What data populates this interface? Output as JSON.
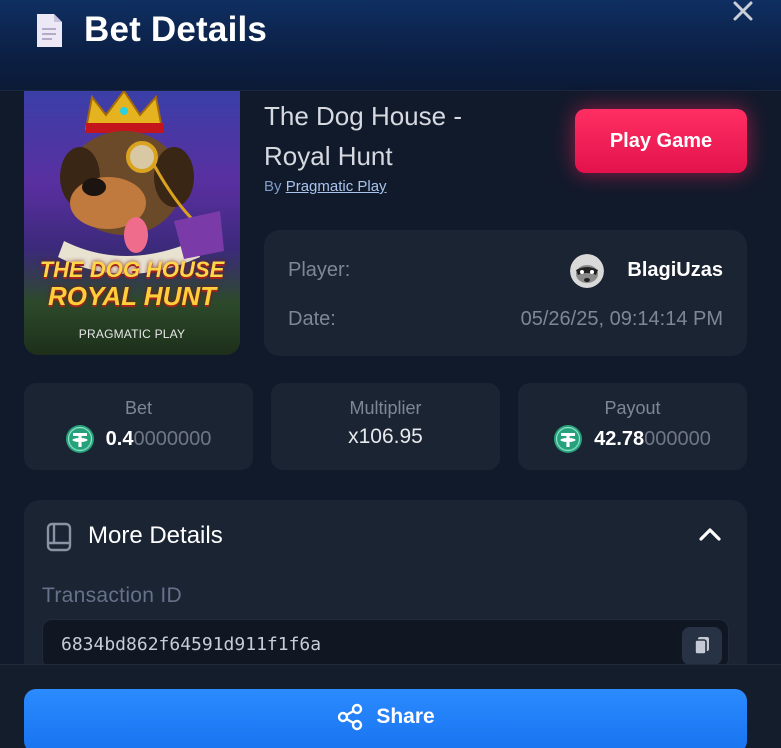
{
  "header": {
    "title": "Bet Details",
    "doc_icon": "document-icon",
    "close_icon": "close-icon"
  },
  "game": {
    "name_line1": "The Dog House -",
    "name_line2": "Royal Hunt",
    "by_label": "By",
    "provider": "Pragmatic Play",
    "thumbnail": {
      "title1": "THE DOG HOUSE",
      "title2": "ROYAL HUNT",
      "provider": "PRAGMATIC PLAY"
    },
    "play_label": "Play Game"
  },
  "info": {
    "player_label": "Player:",
    "player_name": "BlagiUzas",
    "date_label": "Date:",
    "date_value": "05/26/25, 09:14:14 PM"
  },
  "stats": {
    "bet": {
      "label": "Bet",
      "value_strong": "0.4",
      "value_dim": "0000000",
      "coin_icon": "tether-icon"
    },
    "multiplier": {
      "label": "Multiplier",
      "value": "x106.95"
    },
    "payout": {
      "label": "Payout",
      "value_strong": "42.78",
      "value_dim": "000000",
      "coin_icon": "tether-icon"
    }
  },
  "more_details": {
    "title": "More Details",
    "tx_label": "Transaction ID",
    "tx_id": "6834bd862f64591d911f1f6a"
  },
  "share": {
    "label": "Share"
  },
  "colors": {
    "play": "#e3124c",
    "share": "#1f7cf5",
    "background": "#111a2b",
    "card": "#1b2433",
    "coin": "#26a17b"
  }
}
